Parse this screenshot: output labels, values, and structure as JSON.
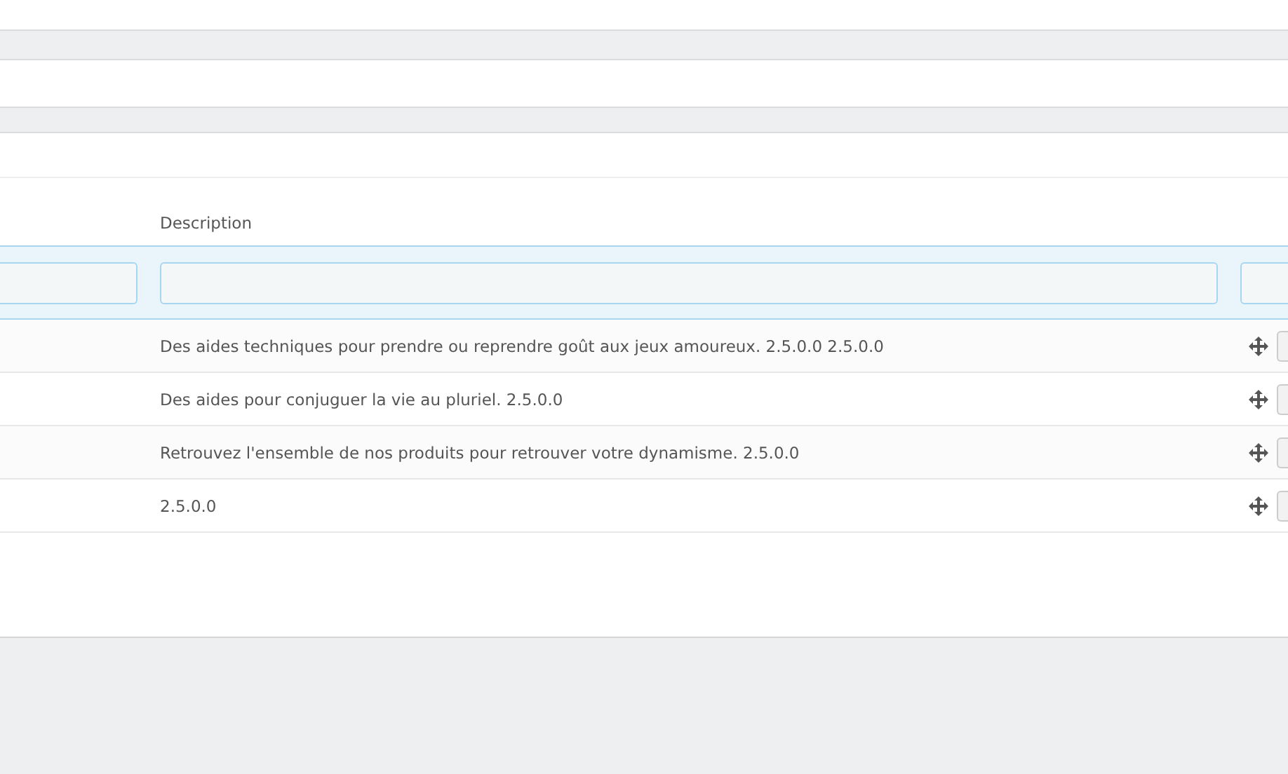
{
  "table": {
    "columns": [
      "Description"
    ],
    "rows": [
      {
        "description": "Des aides techniques pour prendre ou reprendre goût aux jeux amoureux. 2.5.0.0 2.5.0.0"
      },
      {
        "description": "Des aides pour conjuguer la vie au pluriel. 2.5.0.0"
      },
      {
        "description": "Retrouvez l'ensemble de nos produits pour retrouver votre dynamisme. 2.5.0.0"
      },
      {
        "description": "2.5.0.0"
      }
    ]
  }
}
